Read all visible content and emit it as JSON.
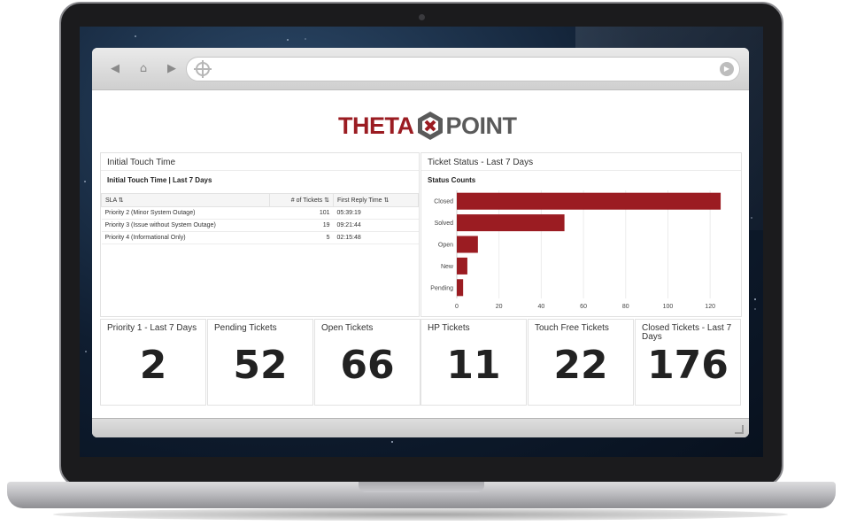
{
  "logo": {
    "part1": "THETA",
    "part2": "POINT"
  },
  "initial_touch": {
    "title": "Initial Touch Time",
    "subtitle": "Initial Touch Time | Last 7 Days",
    "columns": [
      "SLA ⇅",
      "# of Tickets ⇅",
      "First Reply Time ⇅"
    ],
    "rows": [
      {
        "sla": "Priority 2 (Minor System Outage)",
        "tickets": "101",
        "time": "05:39:19"
      },
      {
        "sla": "Priority 3 (Issue without System Outage)",
        "tickets": "19",
        "time": "09:21:44"
      },
      {
        "sla": "Priority 4 (Informational Only)",
        "tickets": "5",
        "time": "02:15:48"
      }
    ]
  },
  "ticket_status": {
    "title": "Ticket Status - Last 7 Days",
    "subtitle": "Status Counts"
  },
  "chart_data": {
    "type": "bar",
    "orientation": "horizontal",
    "categories": [
      "Closed",
      "Solved",
      "Open",
      "New",
      "Pending"
    ],
    "values": [
      125,
      51,
      10,
      5,
      3
    ],
    "xlim": [
      0,
      130
    ],
    "xticks": [
      0,
      20,
      40,
      60,
      80,
      100,
      120
    ],
    "color": "#9b1c22",
    "grid": true
  },
  "stats": [
    {
      "title": "Priority 1 - Last 7 Days",
      "value": "2"
    },
    {
      "title": "Pending Tickets",
      "value": "52"
    },
    {
      "title": "Open Tickets",
      "value": "66"
    },
    {
      "title": "HP Tickets",
      "value": "11"
    },
    {
      "title": "Touch Free Tickets",
      "value": "22"
    },
    {
      "title": "Closed Tickets - Last 7 Days",
      "value": "176"
    }
  ],
  "colors": {
    "brand": "#9b1c22",
    "logo_grey": "#5a5a5a"
  },
  "icons": {
    "back": "chevron-left-icon",
    "home": "home-icon",
    "forward": "chevron-right-icon",
    "address": "crosshair-icon",
    "go": "play-icon"
  }
}
